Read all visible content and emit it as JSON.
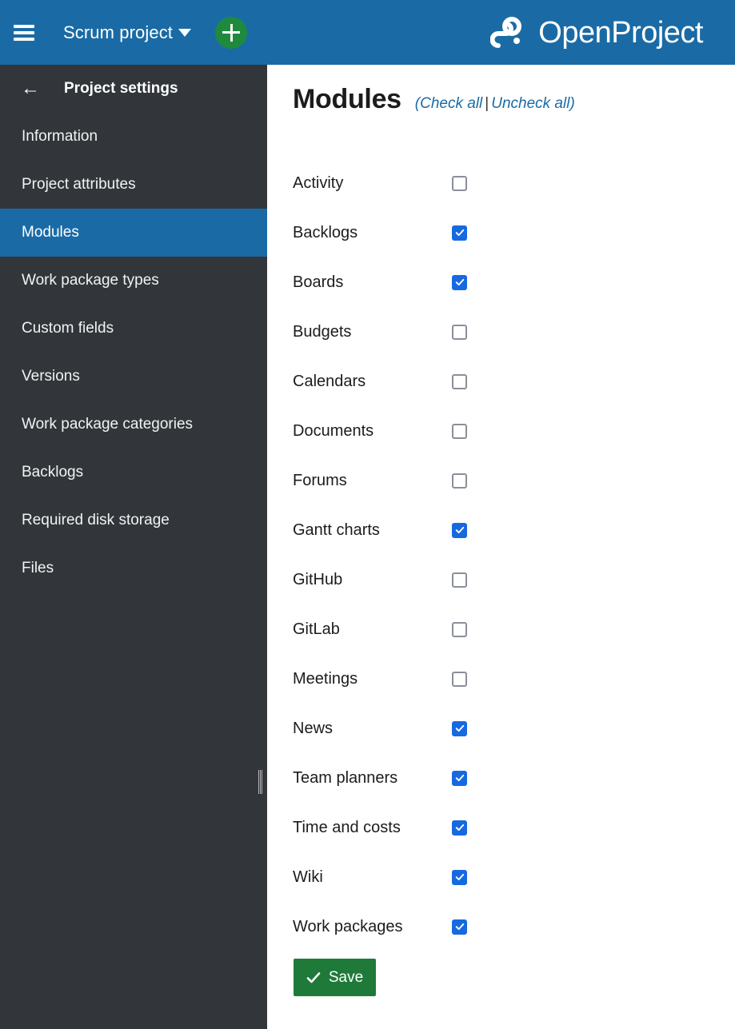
{
  "topbar": {
    "menu_icon": "hamburger-menu-icon",
    "project_name": "Scrum project",
    "project_caret_icon": "chevron-down-icon",
    "add_icon": "plus-icon",
    "add_button_color": "#1f8a3d",
    "brand_name": "OpenProject",
    "brand_logo_icon": "openproject-logo-icon",
    "background_color": "#1a6ba5"
  },
  "sidebar": {
    "back_icon": "arrow-left-icon",
    "title": "Project settings",
    "background_color": "#32363a",
    "selected_color": "#1a6ba5",
    "resize_handle_icon": "drag-handle-icon",
    "items": [
      {
        "label": "Information",
        "selected": false
      },
      {
        "label": "Project attributes",
        "selected": false
      },
      {
        "label": "Modules",
        "selected": true
      },
      {
        "label": "Work package types",
        "selected": false
      },
      {
        "label": "Custom fields",
        "selected": false
      },
      {
        "label": "Versions",
        "selected": false
      },
      {
        "label": "Work package categories",
        "selected": false
      },
      {
        "label": "Backlogs",
        "selected": false
      },
      {
        "label": "Required disk storage",
        "selected": false
      },
      {
        "label": "Files",
        "selected": false
      }
    ]
  },
  "main": {
    "title": "Modules",
    "toggle": {
      "open_paren": "(",
      "check_all": "Check all",
      "separator": "|",
      "uncheck_all": "Uncheck all",
      "close_paren": ")",
      "link_color": "#1a6ba5"
    },
    "checkbox_checked_color": "#1769e0",
    "checkbox_unchecked_border": "#8a8f98",
    "modules": [
      {
        "label": "Activity",
        "checked": false
      },
      {
        "label": "Backlogs",
        "checked": true
      },
      {
        "label": "Boards",
        "checked": true
      },
      {
        "label": "Budgets",
        "checked": false
      },
      {
        "label": "Calendars",
        "checked": false
      },
      {
        "label": "Documents",
        "checked": false
      },
      {
        "label": "Forums",
        "checked": false
      },
      {
        "label": "Gantt charts",
        "checked": true
      },
      {
        "label": "GitHub",
        "checked": false
      },
      {
        "label": "GitLab",
        "checked": false
      },
      {
        "label": "Meetings",
        "checked": false
      },
      {
        "label": "News",
        "checked": true
      },
      {
        "label": "Team planners",
        "checked": true
      },
      {
        "label": "Time and costs",
        "checked": true
      },
      {
        "label": "Wiki",
        "checked": true
      },
      {
        "label": "Work packages",
        "checked": true
      }
    ],
    "save": {
      "label": "Save",
      "icon": "check-icon",
      "color": "#1f7a3a"
    }
  }
}
